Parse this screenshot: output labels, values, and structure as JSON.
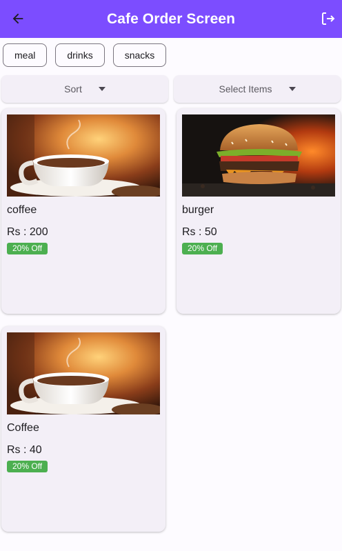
{
  "appbar": {
    "title": "Cafe Order Screen",
    "back_icon": "arrow-back-icon",
    "logout_icon": "logout-icon",
    "color": "#7c4dff"
  },
  "filters": {
    "chips": [
      "meal",
      "drinks",
      "snacks"
    ]
  },
  "sort": {
    "label": "Sort"
  },
  "select": {
    "label": "Select Items"
  },
  "items": [
    {
      "name": "coffee",
      "price": "Rs : 200",
      "discount": "20% Off",
      "image": "coffee-cup-image"
    },
    {
      "name": "burger",
      "price": "Rs : 50",
      "discount": "20% Off",
      "image": "burger-image"
    },
    {
      "name": "Coffee",
      "price": "Rs : 40",
      "discount": "20% Off",
      "image": "coffee-cup-image"
    }
  ],
  "colors": {
    "badge": "#4caf50",
    "card": "#f3eff7"
  }
}
